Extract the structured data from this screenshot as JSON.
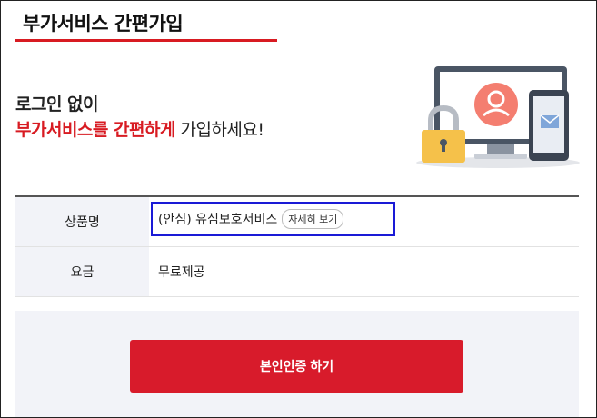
{
  "header": {
    "title": "부가서비스 간편가입"
  },
  "intro": {
    "line1": "로그인 없이",
    "line2_highlight": "부가서비스를 간편하게",
    "line2_rest": " 가입하세요!"
  },
  "table": {
    "rows": [
      {
        "label": "상품명",
        "value": "(안심) 유심보호서비스",
        "detail_button": "자세히 보기"
      },
      {
        "label": "요금",
        "value": "무료제공"
      }
    ]
  },
  "cta": {
    "label": "본인인증 하기"
  },
  "colors": {
    "accent": "#d81b22",
    "highlight_box": "#1a1ad6",
    "table_header_bg": "#f2f3f8"
  },
  "illustration": {
    "icons": [
      "monitor-icon",
      "user-avatar-icon",
      "lock-icon",
      "phone-icon",
      "mail-icon"
    ]
  }
}
